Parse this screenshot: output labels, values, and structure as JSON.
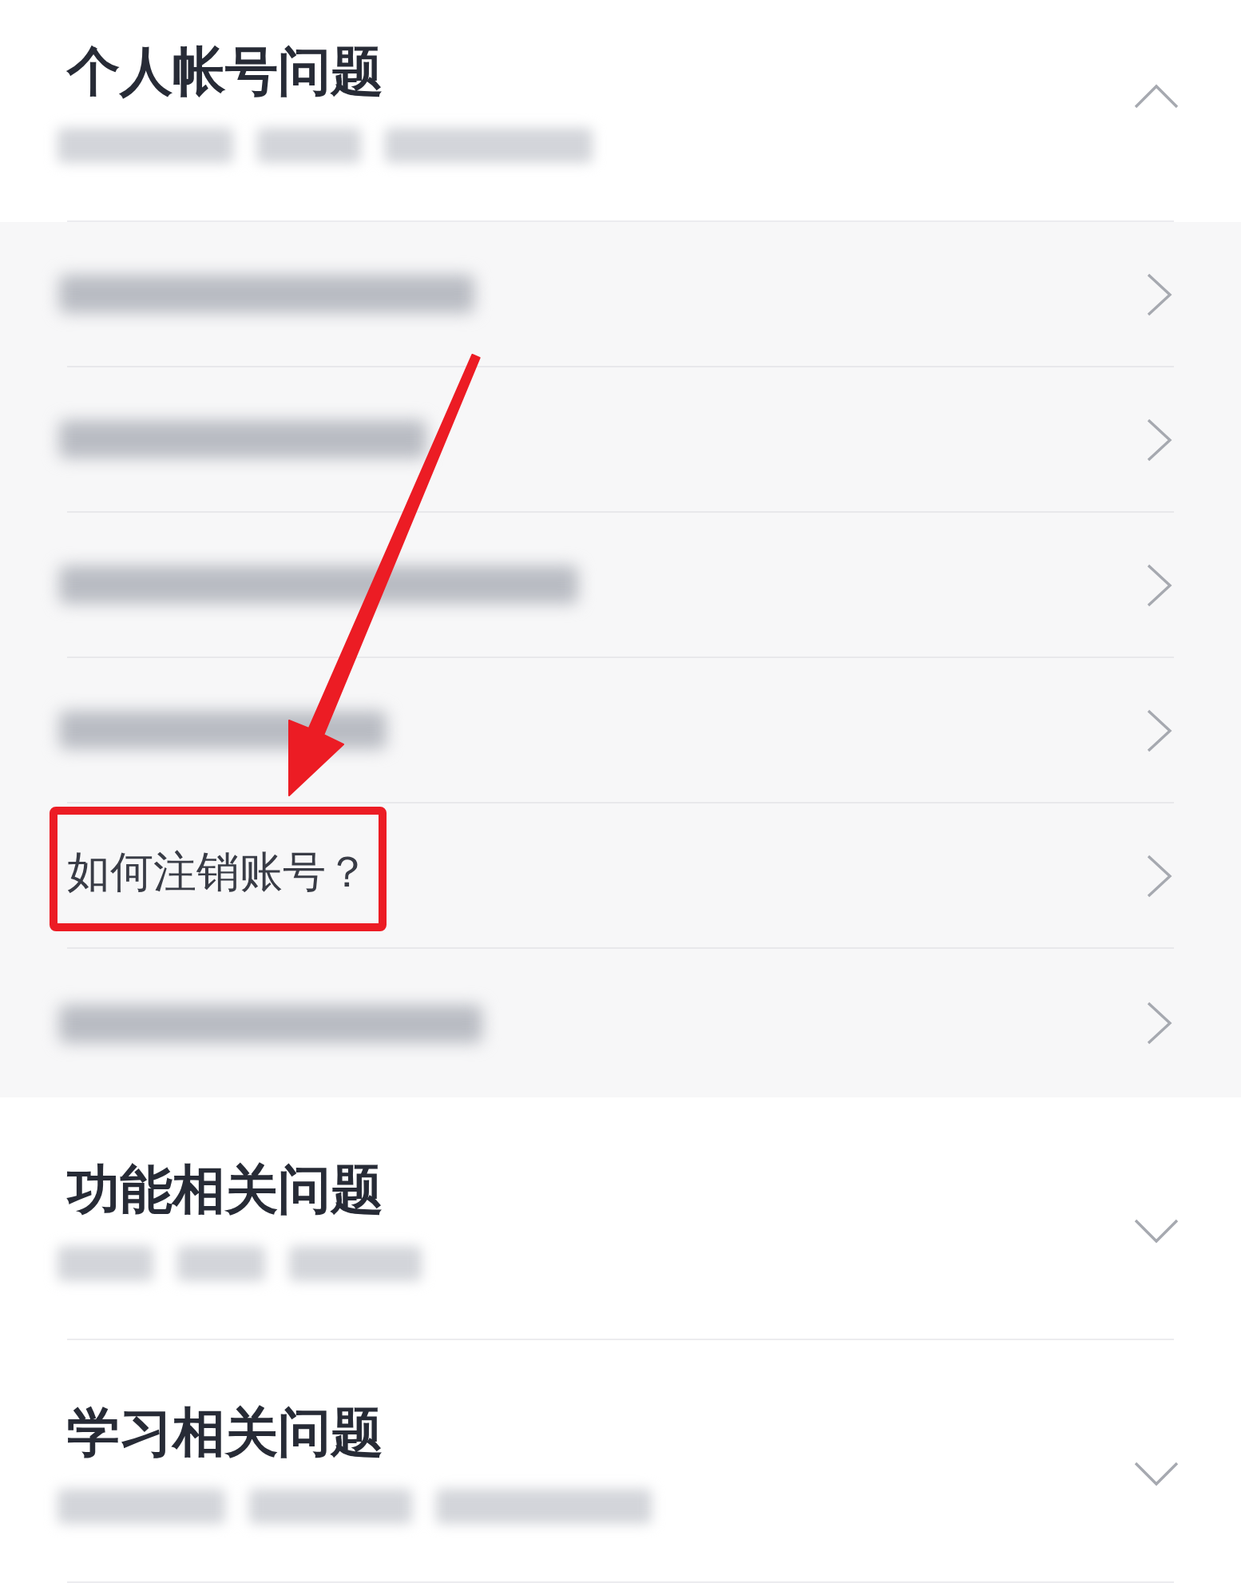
{
  "sections": [
    {
      "title": "个人帐号问题",
      "expanded": true,
      "subtitle": {
        "kind": "blurred"
      },
      "items": [
        {
          "kind": "blurred",
          "highlighted": false
        },
        {
          "kind": "blurred",
          "highlighted": false
        },
        {
          "kind": "blurred",
          "highlighted": false
        },
        {
          "kind": "blurred",
          "highlighted": false
        },
        {
          "kind": "text",
          "label": "如何注销账号？",
          "highlighted": true
        },
        {
          "kind": "blurred",
          "highlighted": false
        }
      ]
    },
    {
      "title": "功能相关问题",
      "expanded": false,
      "subtitle": {
        "kind": "blurred"
      }
    },
    {
      "title": "学习相关问题",
      "expanded": false,
      "subtitle": {
        "kind": "blurred"
      }
    }
  ]
}
